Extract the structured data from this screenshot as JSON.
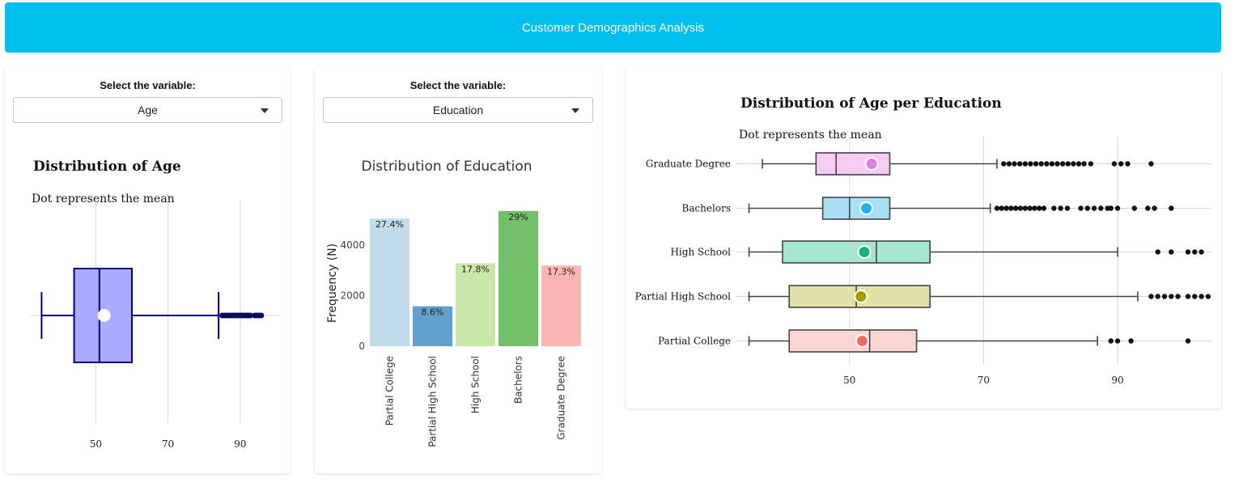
{
  "header": {
    "title": "Customer Demographics Analysis",
    "color": "#00bfee"
  },
  "panel_left": {
    "select_label": "Select the variable:",
    "selected": "Age"
  },
  "panel_middle": {
    "select_label": "Select the variable:",
    "selected": "Education"
  },
  "chart_data": [
    {
      "type": "box",
      "title": "Distribution of Age",
      "subtitle": "Dot represents the mean",
      "orientation": "horizontal",
      "xticks": [
        50,
        70,
        90
      ],
      "xlim": [
        32,
        101
      ],
      "box": {
        "whisker_low": 35,
        "q1": 44,
        "median": 51,
        "q3": 60,
        "whisker_high": 84,
        "mean": 52.3
      },
      "outliers": [
        85,
        85.6,
        86.2,
        86.8,
        87.4,
        88,
        88.6,
        89.2,
        89.8,
        90.4,
        91,
        91.6,
        92.2,
        92.8,
        94,
        94.6,
        95.2,
        95.8
      ],
      "fill": "#aaaaff",
      "stroke": "#000080"
    },
    {
      "type": "bar",
      "title": "Distribution of Education",
      "ylabel": "Frequency (N)",
      "categories": [
        "Partial College",
        "Partial High School",
        "High School",
        "Bachelors",
        "Graduate Degree"
      ],
      "values": [
        5050,
        1580,
        3280,
        5350,
        3190
      ],
      "labels": [
        "27.4%",
        "8.6%",
        "17.8%",
        "29%",
        "17.3%"
      ],
      "colors": [
        "#c0dcea",
        "#62a0cb",
        "#cae8a9",
        "#72be69",
        "#fdb5b3"
      ],
      "yticks": [
        0,
        2000,
        4000
      ],
      "ylim": [
        0,
        5600
      ]
    },
    {
      "type": "box",
      "title": "Distribution of Age per Education",
      "subtitle": "Dot represents the mean",
      "orientation": "horizontal",
      "xticks": [
        50,
        70,
        90
      ],
      "xlim": [
        33,
        104
      ],
      "series": [
        {
          "name": "Graduate Degree",
          "whisker_low": 37,
          "q1": 45,
          "median": 48,
          "q3": 56,
          "whisker_high": 72,
          "mean": 53.3,
          "outliers": [
            73,
            73.8,
            74.6,
            75.4,
            76.2,
            77,
            77.8,
            78.6,
            79.4,
            80.2,
            81,
            81.8,
            82.6,
            83.4,
            84.2,
            85,
            86,
            89.5,
            90.5,
            91.5,
            95
          ],
          "fill": "#f4ccf4",
          "stroke": "#444444",
          "dot": "#dd7fe0"
        },
        {
          "name": "Bachelors",
          "whisker_low": 35,
          "q1": 46,
          "median": 50,
          "q3": 56,
          "whisker_high": 71,
          "mean": 52.5,
          "outliers": [
            72,
            72.7,
            73.4,
            74.1,
            74.8,
            75.5,
            76.2,
            76.9,
            77.6,
            78.3,
            79,
            80.5,
            81.5,
            82.5,
            84.5,
            85.5,
            86.5,
            87.5,
            88.5,
            89,
            90,
            92.5,
            94.5,
            95.5,
            98
          ],
          "fill": "#a9dff5",
          "stroke": "#444444",
          "dot": "#21b1ec"
        },
        {
          "name": "High School",
          "whisker_low": 35,
          "q1": 40,
          "median": 54,
          "q3": 62,
          "whisker_high": 90,
          "mean": 52.2,
          "outliers": [
            96,
            98,
            100.5,
            101.5,
            102.5
          ],
          "fill": "#a5e6d0",
          "stroke": "#444444",
          "dot": "#16b27a"
        },
        {
          "name": "Partial High School",
          "whisker_low": 35,
          "q1": 41,
          "median": 51,
          "q3": 62,
          "whisker_high": 93,
          "mean": 51.7,
          "outliers": [
            95,
            96,
            97,
            98,
            99,
            100.5,
            101.5,
            102.5,
            103.5
          ],
          "fill": "#e2e1a7",
          "stroke": "#444444",
          "dot": "#a29d07"
        },
        {
          "name": "Partial College",
          "whisker_low": 35,
          "q1": 41,
          "median": 53,
          "q3": 60,
          "whisker_high": 87,
          "mean": 51.9,
          "outliers": [
            89,
            90,
            92,
            100.5
          ],
          "fill": "#fcd6d2",
          "stroke": "#444444",
          "dot": "#f46c61"
        }
      ]
    }
  ]
}
